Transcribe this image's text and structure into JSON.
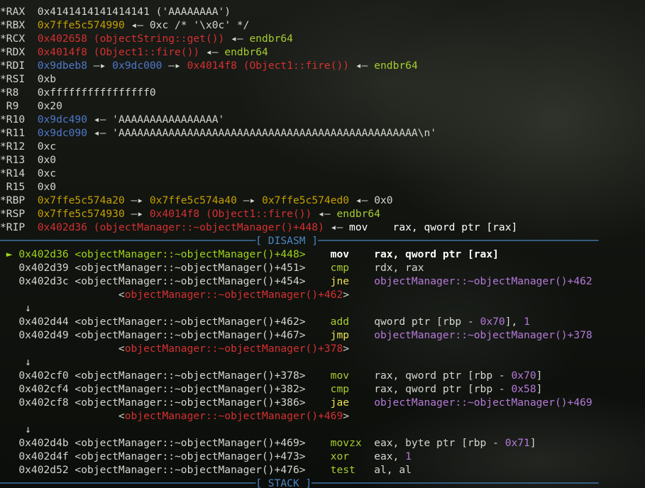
{
  "colors": {
    "default": "#d3d7cf",
    "stack_addr": "#c4a000",
    "code_addr": "#d43131",
    "heap_addr": "#4e79c9",
    "instruction": "#a6cc2e",
    "symbol_target": "#b57ad8",
    "banner": "#4a86c5",
    "current_line": "#9fd41a"
  },
  "lines": [
    [
      {
        "t": "*RAX  ",
        "c": "gray"
      },
      {
        "t": "0x4141414141414141 ('AAAAAAAA')",
        "c": "gray"
      }
    ],
    [
      {
        "t": "*RBX  ",
        "c": "gray"
      },
      {
        "t": "0x7ffe5c574990",
        "c": "yellow"
      },
      {
        "t": " ◂— 0xc /* '\\x0c' */",
        "c": "gray"
      }
    ],
    [
      {
        "t": "*RCX  ",
        "c": "gray"
      },
      {
        "t": "0x402658 (objectString::get())",
        "c": "red"
      },
      {
        "t": " ◂— ",
        "c": "gray"
      },
      {
        "t": "endbr64",
        "c": "green"
      }
    ],
    [
      {
        "t": "*RDX  ",
        "c": "gray"
      },
      {
        "t": "0x4014f8 (Object1::fire())",
        "c": "red"
      },
      {
        "t": " ◂— ",
        "c": "gray"
      },
      {
        "t": "endbr64",
        "c": "green"
      }
    ],
    [
      {
        "t": "*RDI  ",
        "c": "gray"
      },
      {
        "t": "0x9dbeb8",
        "c": "blue"
      },
      {
        "t": " —▸ ",
        "c": "gray"
      },
      {
        "t": "0x9dc000",
        "c": "blue"
      },
      {
        "t": " —▸ ",
        "c": "gray"
      },
      {
        "t": "0x4014f8 (Object1::fire())",
        "c": "red"
      },
      {
        "t": " ◂— ",
        "c": "gray"
      },
      {
        "t": "endbr64",
        "c": "green"
      }
    ],
    [
      {
        "t": "*RSI  ",
        "c": "gray"
      },
      {
        "t": "0xb",
        "c": "gray"
      }
    ],
    [
      {
        "t": "*R8   ",
        "c": "gray"
      },
      {
        "t": "0xffffffffffffffff0",
        "c": "gray"
      }
    ],
    [
      {
        "t": " R9   ",
        "c": "gray"
      },
      {
        "t": "0x20",
        "c": "gray"
      }
    ],
    [
      {
        "t": "*R10  ",
        "c": "gray"
      },
      {
        "t": "0x9dc490",
        "c": "blue"
      },
      {
        "t": " ◂— 'AAAAAAAAAAAAAAAA'",
        "c": "gray"
      }
    ],
    [
      {
        "t": "*R11  ",
        "c": "gray"
      },
      {
        "t": "0x9dc090",
        "c": "blue"
      },
      {
        "t": " ◂— 'AAAAAAAAAAAAAAAAAAAAAAAAAAAAAAAAAAAAAAAAAAAAAAAA\\n'",
        "c": "gray"
      }
    ],
    [
      {
        "t": "*R12  ",
        "c": "gray"
      },
      {
        "t": "0xc",
        "c": "gray"
      }
    ],
    [
      {
        "t": "*R13  ",
        "c": "gray"
      },
      {
        "t": "0x0",
        "c": "gray"
      }
    ],
    [
      {
        "t": "*R14  ",
        "c": "gray"
      },
      {
        "t": "0xc",
        "c": "gray"
      }
    ],
    [
      {
        "t": " R15  ",
        "c": "gray"
      },
      {
        "t": "0x0",
        "c": "gray"
      }
    ],
    [
      {
        "t": "*RBP  ",
        "c": "gray"
      },
      {
        "t": "0x7ffe5c574a20",
        "c": "yellow"
      },
      {
        "t": " —▸ ",
        "c": "gray"
      },
      {
        "t": "0x7ffe5c574a40",
        "c": "yellow"
      },
      {
        "t": " —▸ ",
        "c": "gray"
      },
      {
        "t": "0x7ffe5c574ed0",
        "c": "yellow"
      },
      {
        "t": " ◂— 0x0",
        "c": "gray"
      }
    ],
    [
      {
        "t": "*RSP  ",
        "c": "gray"
      },
      {
        "t": "0x7ffe5c574930",
        "c": "yellow"
      },
      {
        "t": " —▸ ",
        "c": "gray"
      },
      {
        "t": "0x4014f8 (Object1::fire())",
        "c": "red"
      },
      {
        "t": " ◂— ",
        "c": "gray"
      },
      {
        "t": "endbr64",
        "c": "green"
      }
    ],
    [
      {
        "t": "*RIP  ",
        "c": "gray"
      },
      {
        "t": "0x402d36 (objectManager::~objectManager()+448)",
        "c": "red"
      },
      {
        "t": " ◂— ",
        "c": "gray"
      },
      {
        "t": "mov    rax, qword ptr [rax]",
        "c": "white"
      }
    ],
    [
      {
        "t": "─────────────────────────────────────────[ DISASM ]─────────────────────────────────────────────",
        "c": "banner"
      }
    ],
    [
      {
        "t": " ► 0x402d36 <objectManager::~objectManager()+448>    ",
        "c": "cur"
      },
      {
        "t": "mov    rax, qword ptr [rax]",
        "c": "bold"
      }
    ],
    [
      {
        "t": "   0x402d39 <objectManager::~objectManager()+451>    ",
        "c": "gray"
      },
      {
        "t": "cmp    ",
        "c": "green"
      },
      {
        "t": "rdx, rax",
        "c": "gray"
      }
    ],
    [
      {
        "t": "   0x402d3c <objectManager::~objectManager()+454>    ",
        "c": "gray"
      },
      {
        "t": "jne    ",
        "c": "yellowb"
      },
      {
        "t": "objectManager::~objectManager()+462",
        "c": "purple"
      }
    ],
    [
      {
        "t": "                   <",
        "c": "gray"
      },
      {
        "t": "objectManager::~objectManager()+462",
        "c": "red"
      },
      {
        "t": ">",
        "c": "gray"
      }
    ],
    [
      {
        "t": "    ↓",
        "c": "gray"
      }
    ],
    [
      {
        "t": "   0x402d44 <objectManager::~objectManager()+462>    ",
        "c": "gray"
      },
      {
        "t": "add    ",
        "c": "green"
      },
      {
        "t": "qword ptr [rbp - ",
        "c": "gray"
      },
      {
        "t": "0x70",
        "c": "purple"
      },
      {
        "t": "], ",
        "c": "gray"
      },
      {
        "t": "1",
        "c": "purple"
      }
    ],
    [
      {
        "t": "   0x402d49 <objectManager::~objectManager()+467>    ",
        "c": "gray"
      },
      {
        "t": "jmp    ",
        "c": "yellowb"
      },
      {
        "t": "objectManager::~objectManager()+378",
        "c": "purple"
      }
    ],
    [
      {
        "t": "                   <",
        "c": "gray"
      },
      {
        "t": "objectManager::~objectManager()+378",
        "c": "red"
      },
      {
        "t": ">",
        "c": "gray"
      }
    ],
    [
      {
        "t": "    ↓",
        "c": "gray"
      }
    ],
    [
      {
        "t": "   0x402cf0 <objectManager::~objectManager()+378>    ",
        "c": "gray"
      },
      {
        "t": "mov    ",
        "c": "green"
      },
      {
        "t": "rax, qword ptr [rbp - ",
        "c": "gray"
      },
      {
        "t": "0x70",
        "c": "purple"
      },
      {
        "t": "]",
        "c": "gray"
      }
    ],
    [
      {
        "t": "   0x402cf4 <objectManager::~objectManager()+382>    ",
        "c": "gray"
      },
      {
        "t": "cmp    ",
        "c": "green"
      },
      {
        "t": "rax, qword ptr [rbp - ",
        "c": "gray"
      },
      {
        "t": "0x58",
        "c": "purple"
      },
      {
        "t": "]",
        "c": "gray"
      }
    ],
    [
      {
        "t": "   0x402cf8 <objectManager::~objectManager()+386>    ",
        "c": "gray"
      },
      {
        "t": "jae    ",
        "c": "yellowb"
      },
      {
        "t": "objectManager::~objectManager()+469",
        "c": "purple"
      }
    ],
    [
      {
        "t": "                   <",
        "c": "gray"
      },
      {
        "t": "objectManager::~objectManager()+469",
        "c": "red"
      },
      {
        "t": ">",
        "c": "gray"
      }
    ],
    [
      {
        "t": "    ↓",
        "c": "gray"
      }
    ],
    [
      {
        "t": "   0x402d4b <objectManager::~objectManager()+469>    ",
        "c": "gray"
      },
      {
        "t": "movzx  ",
        "c": "green"
      },
      {
        "t": "eax, byte ptr [rbp - ",
        "c": "gray"
      },
      {
        "t": "0x71",
        "c": "purple"
      },
      {
        "t": "]",
        "c": "gray"
      }
    ],
    [
      {
        "t": "   0x402d4f <objectManager::~objectManager()+473>    ",
        "c": "gray"
      },
      {
        "t": "xor    ",
        "c": "green"
      },
      {
        "t": "eax, ",
        "c": "gray"
      },
      {
        "t": "1",
        "c": "purple"
      }
    ],
    [
      {
        "t": "   0x402d52 <objectManager::~objectManager()+476>    ",
        "c": "gray"
      },
      {
        "t": "test   ",
        "c": "green"
      },
      {
        "t": "al, al",
        "c": "gray"
      }
    ],
    [
      {
        "t": "─────────────────────────────────────────[ STACK ]──────────────────────────────────────────────",
        "c": "banner"
      }
    ]
  ]
}
